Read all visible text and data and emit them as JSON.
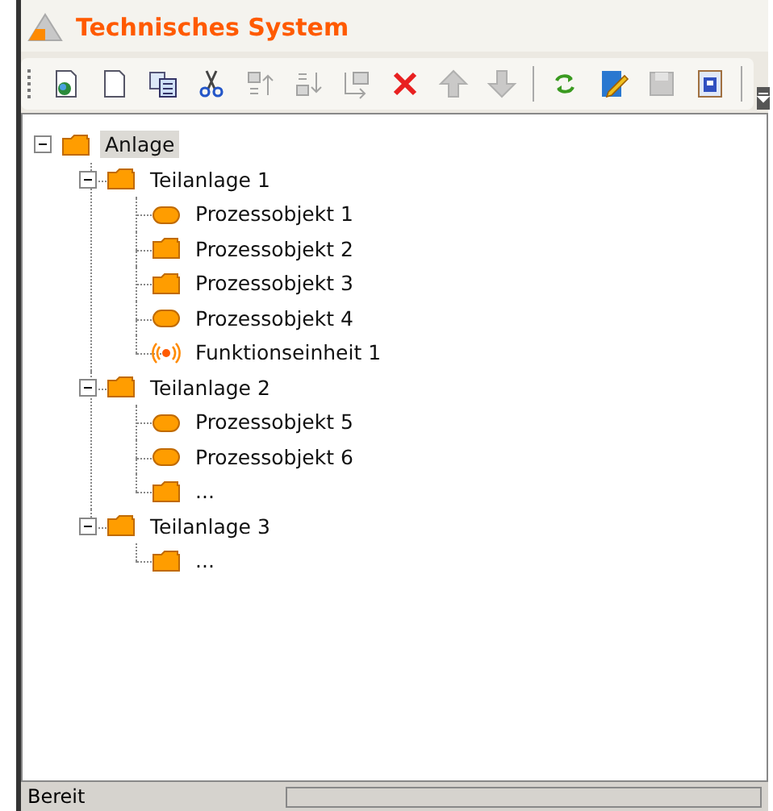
{
  "window": {
    "title": "Technisches System"
  },
  "toolbar": [
    {
      "kind": "new-globe",
      "disabled": false
    },
    {
      "kind": "blank",
      "disabled": false
    },
    {
      "kind": "copy",
      "disabled": false
    },
    {
      "kind": "cut",
      "disabled": false
    },
    {
      "kind": "up-list",
      "disabled": true
    },
    {
      "kind": "down-list",
      "disabled": true
    },
    {
      "kind": "move-list",
      "disabled": true
    },
    {
      "kind": "delete",
      "disabled": false
    },
    {
      "kind": "arrow-up",
      "disabled": true
    },
    {
      "kind": "arrow-down",
      "disabled": true
    },
    {
      "kind": "separator",
      "disabled": false
    },
    {
      "kind": "refresh",
      "disabled": false
    },
    {
      "kind": "edit",
      "disabled": false
    },
    {
      "kind": "save",
      "disabled": true
    },
    {
      "kind": "save-as",
      "disabled": false
    },
    {
      "kind": "separator",
      "disabled": false
    }
  ],
  "tree": [
    {
      "label": "Anlage",
      "kind": "folder",
      "selected": true,
      "expanded": true,
      "children": [
        {
          "label": "Teilanlage 1",
          "kind": "folder",
          "selected": false,
          "expanded": true,
          "children": [
            {
              "label": "Prozessobjekt 1",
              "kind": "capsule",
              "selected": false
            },
            {
              "label": "Prozessobjekt 2",
              "kind": "folder",
              "selected": false
            },
            {
              "label": "Prozessobjekt 3",
              "kind": "folder",
              "selected": false
            },
            {
              "label": "Prozessobjekt 4",
              "kind": "capsule",
              "selected": false
            },
            {
              "label": "Funktionseinheit 1",
              "kind": "signal",
              "selected": false
            }
          ]
        },
        {
          "label": "Teilanlage 2",
          "kind": "folder",
          "selected": false,
          "expanded": true,
          "children": [
            {
              "label": "Prozessobjekt 5",
              "kind": "capsule",
              "selected": false
            },
            {
              "label": "Prozessobjekt 6",
              "kind": "capsule",
              "selected": false
            },
            {
              "label": "...",
              "kind": "folder",
              "selected": false
            }
          ]
        },
        {
          "label": "Teilanlage 3",
          "kind": "folder",
          "selected": false,
          "expanded": true,
          "children": [
            {
              "label": "...",
              "kind": "folder",
              "selected": false
            }
          ]
        }
      ]
    }
  ],
  "status_bar": {
    "text": "Bereit",
    "progress": {
      "level": 0
    }
  }
}
